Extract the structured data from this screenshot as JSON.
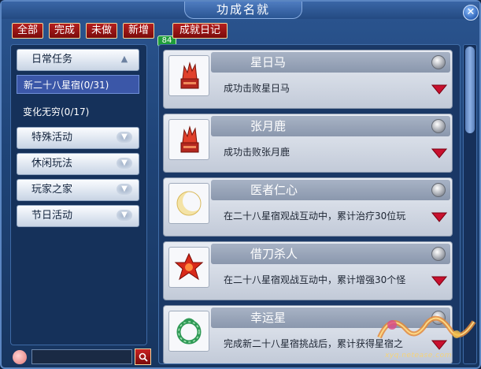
{
  "window": {
    "title": "功成名就"
  },
  "tabs": [
    {
      "label": "全部"
    },
    {
      "label": "完成"
    },
    {
      "label": "未做"
    },
    {
      "label": "新增",
      "badge": "84"
    },
    {
      "label": "成就日记"
    }
  ],
  "sidebar": {
    "categories": [
      {
        "label": "日常任务",
        "expanded": true
      },
      {
        "label": "特殊活动"
      },
      {
        "label": "休闲玩法"
      },
      {
        "label": "玩家之家"
      },
      {
        "label": "节日活动"
      }
    ],
    "subitems": [
      {
        "label": "新二十八星宿(0/31)",
        "selected": true
      },
      {
        "label": "变化无穷(0/17)"
      }
    ]
  },
  "search": {
    "value": "",
    "placeholder": ""
  },
  "achievements": [
    {
      "title": "星日马",
      "description": "成功击败星日马",
      "icon": "red-flame-altar-icon"
    },
    {
      "title": "张月鹿",
      "description": "成功击败张月鹿",
      "icon": "red-flame-altar-icon"
    },
    {
      "title": "医者仁心",
      "description": "在二十八星宿观战互动中，累计治疗30位玩",
      "icon": "crescent-moon-icon"
    },
    {
      "title": "借刀杀人",
      "description": "在二十八星宿观战互动中，累计增强30个怪",
      "icon": "red-star-icon"
    },
    {
      "title": "幸运星",
      "description": "完成新二十八星宿挑战后，累计获得星宿之",
      "icon": "green-dragon-ring-icon"
    }
  ],
  "watermark": {
    "text": "xyq.netease.com"
  },
  "colors": {
    "accent_red": "#b51f1f",
    "badge_green": "#1f9d3a",
    "window_blue": "#1f4478"
  }
}
